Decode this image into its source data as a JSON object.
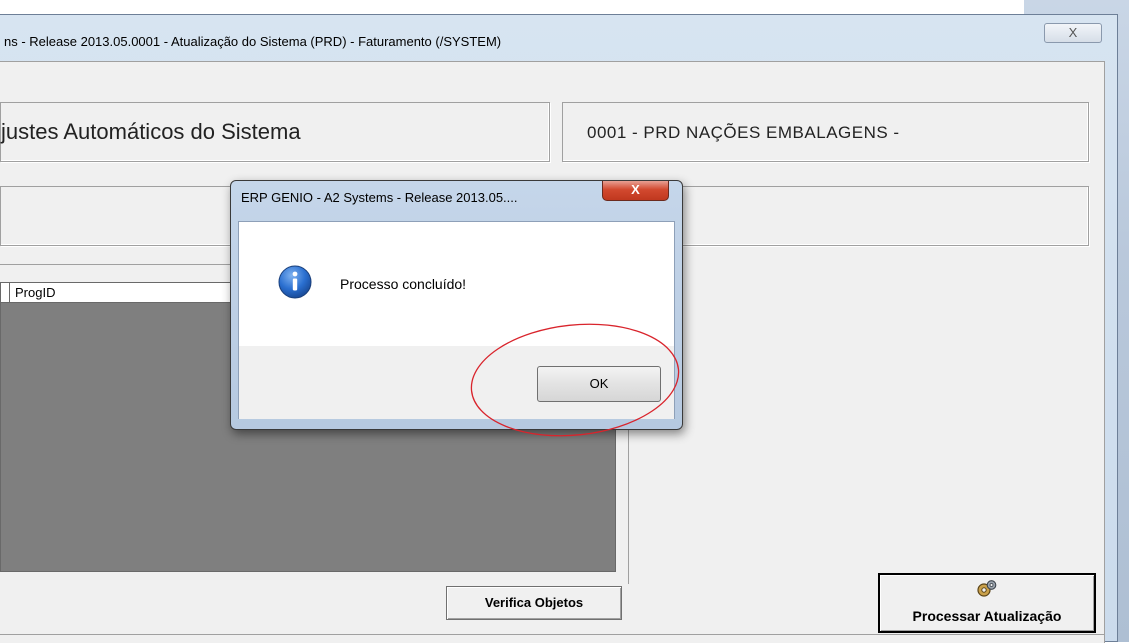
{
  "main_window": {
    "title": "ns - Release 2013.05.0001 - Atualização do Sistema (PRD) - Faturamento (/SYSTEM)",
    "close_glyph": "X",
    "header_title": "justes Automáticos do Sistema",
    "company": "0001  -  PRD  NAÇÕES EMBALAGENS -",
    "grid": {
      "columns": [
        "ProgID"
      ]
    },
    "buttons": {
      "verifica": "Verifica Objetos",
      "processar": "Processar Atualização"
    }
  },
  "dialog": {
    "title": "ERP GENIO - A2 Systems - Release 2013.05....",
    "close_glyph": "X",
    "message": "Processo concluído!",
    "ok_label": "OK",
    "icon": "info-icon"
  },
  "colors": {
    "grid_background": "#7f7f7f",
    "annotation": "#d9242c",
    "dialog_close": "#c9402a"
  }
}
